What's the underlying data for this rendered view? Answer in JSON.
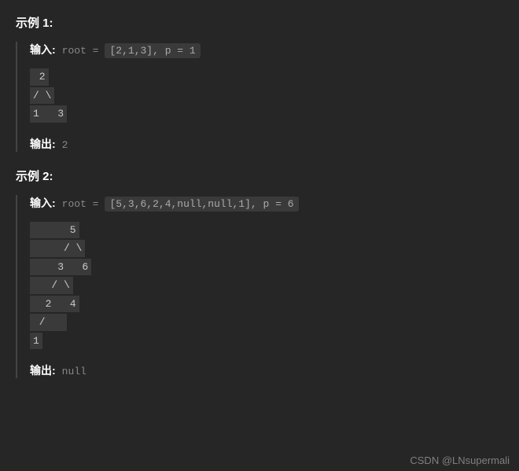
{
  "example1": {
    "heading": "示例 1:",
    "input_label": "输入:",
    "input_prefix": "root = ",
    "input_code": "[2,1,3], p = 1",
    "tree_lines": [
      " 2",
      "/ \\",
      "1   3"
    ],
    "output_label": "输出:",
    "output_value": "2"
  },
  "example2": {
    "heading": "示例 2:",
    "input_label": "输入:",
    "input_prefix": "root = ",
    "input_code": "[5,3,6,2,4,null,null,1], p = 6",
    "tree_lines": [
      "      5",
      "     / \\",
      "    3   6",
      "   / \\",
      "  2   4",
      " /   ",
      "1"
    ],
    "output_label": "输出:",
    "output_value": "null"
  },
  "watermark": "CSDN @LNsupermali"
}
